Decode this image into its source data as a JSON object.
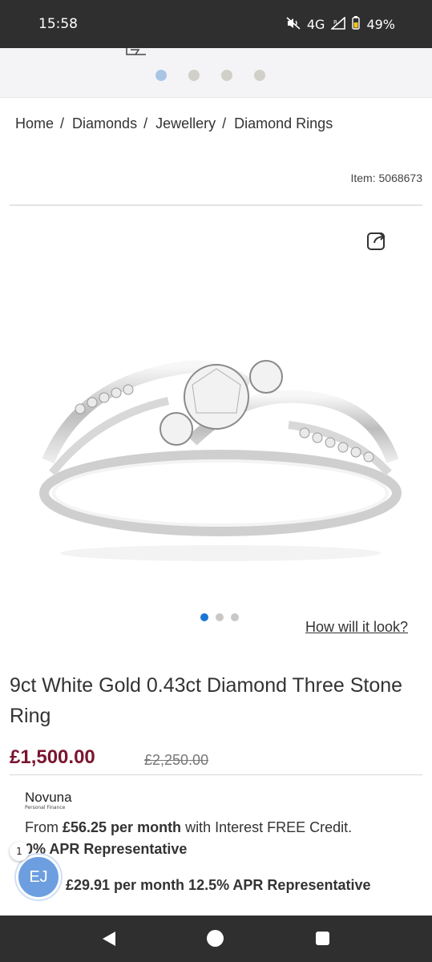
{
  "status_bar": {
    "time": "15:58",
    "network": "4G",
    "roaming": "R",
    "battery": "49%",
    "icons": [
      "mute-icon",
      "signal-icon",
      "battery-icon"
    ]
  },
  "promo_carousel": {
    "slide_count": 4,
    "active_index": 0
  },
  "breadcrumb": {
    "items": [
      "Home",
      "Diamonds",
      "Jewellery",
      "Diamond Rings"
    ],
    "separator": "/"
  },
  "item_number": "Item: 5068673",
  "gallery": {
    "image_count": 3,
    "active_index": 0,
    "how_link": "How will it look?"
  },
  "product": {
    "title": "9ct White Gold 0.43ct Diamond Three Stone Ring",
    "price": "£1,500.00",
    "was_price": "£2,250.00"
  },
  "finance": {
    "provider": "Novuna",
    "provider_sub": "Personal Finance",
    "option1_prefix": "From ",
    "option1_amount": "£56.25 per month",
    "option1_suffix": " with Interest FREE Credit.",
    "option1_apr": "0% APR Representative",
    "option2": "£29.91 per month 12.5% APR Representative"
  },
  "chat_widget": {
    "initials": "EJ",
    "badge_count": "1"
  },
  "colors": {
    "price": "#7a1531",
    "active_dot": "#1b76d2",
    "avatar": "#6d9fe0"
  }
}
